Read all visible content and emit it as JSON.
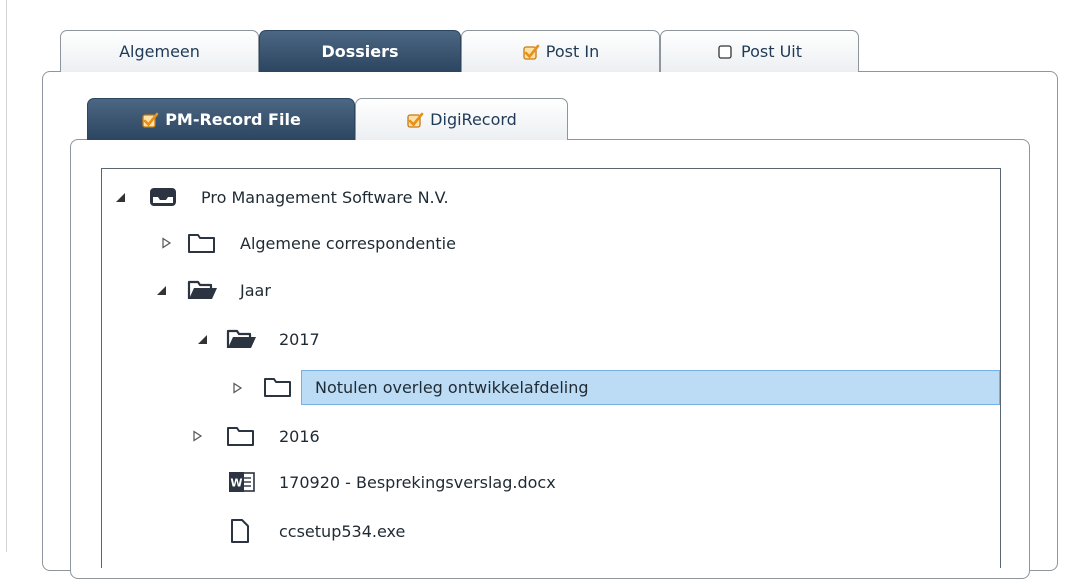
{
  "outer_tabs": [
    {
      "label": "Algemeen",
      "active": false,
      "icon": "none"
    },
    {
      "label": "Dossiers",
      "active": true,
      "icon": "none"
    },
    {
      "label": "Post In",
      "active": false,
      "icon": "checked-checkbox-icon"
    },
    {
      "label": "Post Uit",
      "active": false,
      "icon": "empty-checkbox-icon"
    }
  ],
  "inner_tabs": [
    {
      "label": "PM-Record File",
      "active": true,
      "icon": "checked-checkbox-icon"
    },
    {
      "label": "DigiRecord",
      "active": false,
      "icon": "checked-checkbox-icon"
    }
  ],
  "tree": [
    {
      "label": "Pro Management Software N.V.",
      "level": 0,
      "expander": "expanded",
      "icon": "drawer-icon",
      "selected": false
    },
    {
      "label": "Algemene correspondentie",
      "level": 1,
      "expander": "collapsed",
      "icon": "folder-icon",
      "selected": false
    },
    {
      "label": "Jaar",
      "level": 1,
      "expander": "expanded",
      "icon": "folder-open-icon",
      "selected": false
    },
    {
      "label": "2017",
      "level": 2,
      "expander": "expanded",
      "icon": "folder-open-icon",
      "selected": false
    },
    {
      "label": "Notulen overleg ontwikkelafdeling",
      "level": 3,
      "expander": "collapsed",
      "icon": "folder-icon",
      "selected": true
    },
    {
      "label": "2016",
      "level": 2,
      "expander": "collapsed",
      "icon": "folder-icon",
      "selected": false
    },
    {
      "label": "170920 - Besprekingsverslag.docx",
      "level": 3,
      "expander": "none",
      "icon": "word-doc-icon",
      "selected": false
    },
    {
      "label": "ccsetup534.exe",
      "level": 3,
      "expander": "none",
      "icon": "file-icon",
      "selected": false
    }
  ],
  "colors": {
    "active_tab": "#2c4561",
    "selection": "#bcdcf6",
    "checkbox_orange": "#f0a020"
  }
}
